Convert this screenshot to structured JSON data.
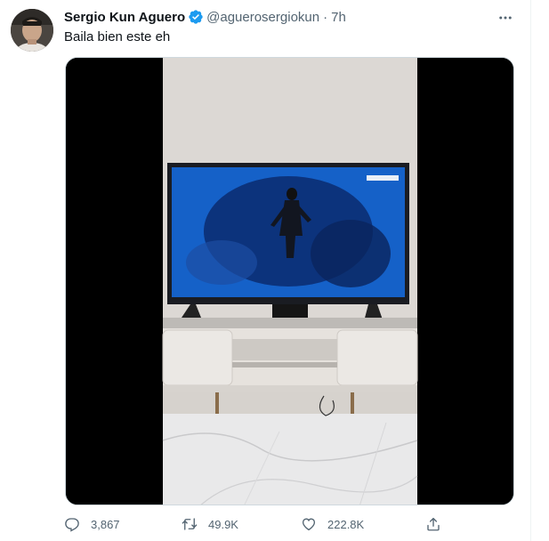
{
  "tweet": {
    "author_name": "Sergio Kun Aguero",
    "handle": "@aguerosergiokun",
    "separator": "·",
    "time": "7h",
    "text": "Baila bien este eh",
    "verified": true
  },
  "actions": {
    "replies": "3,867",
    "retweets": "49.9K",
    "likes": "222.8K"
  },
  "icons": {
    "verified": "verified-badge-icon",
    "more": "more-icon",
    "reply": "reply-icon",
    "retweet": "retweet-icon",
    "like": "like-icon",
    "share": "share-icon"
  },
  "colors": {
    "accent": "#1d9bf0",
    "text": "#0f1419",
    "secondary": "#536471"
  }
}
